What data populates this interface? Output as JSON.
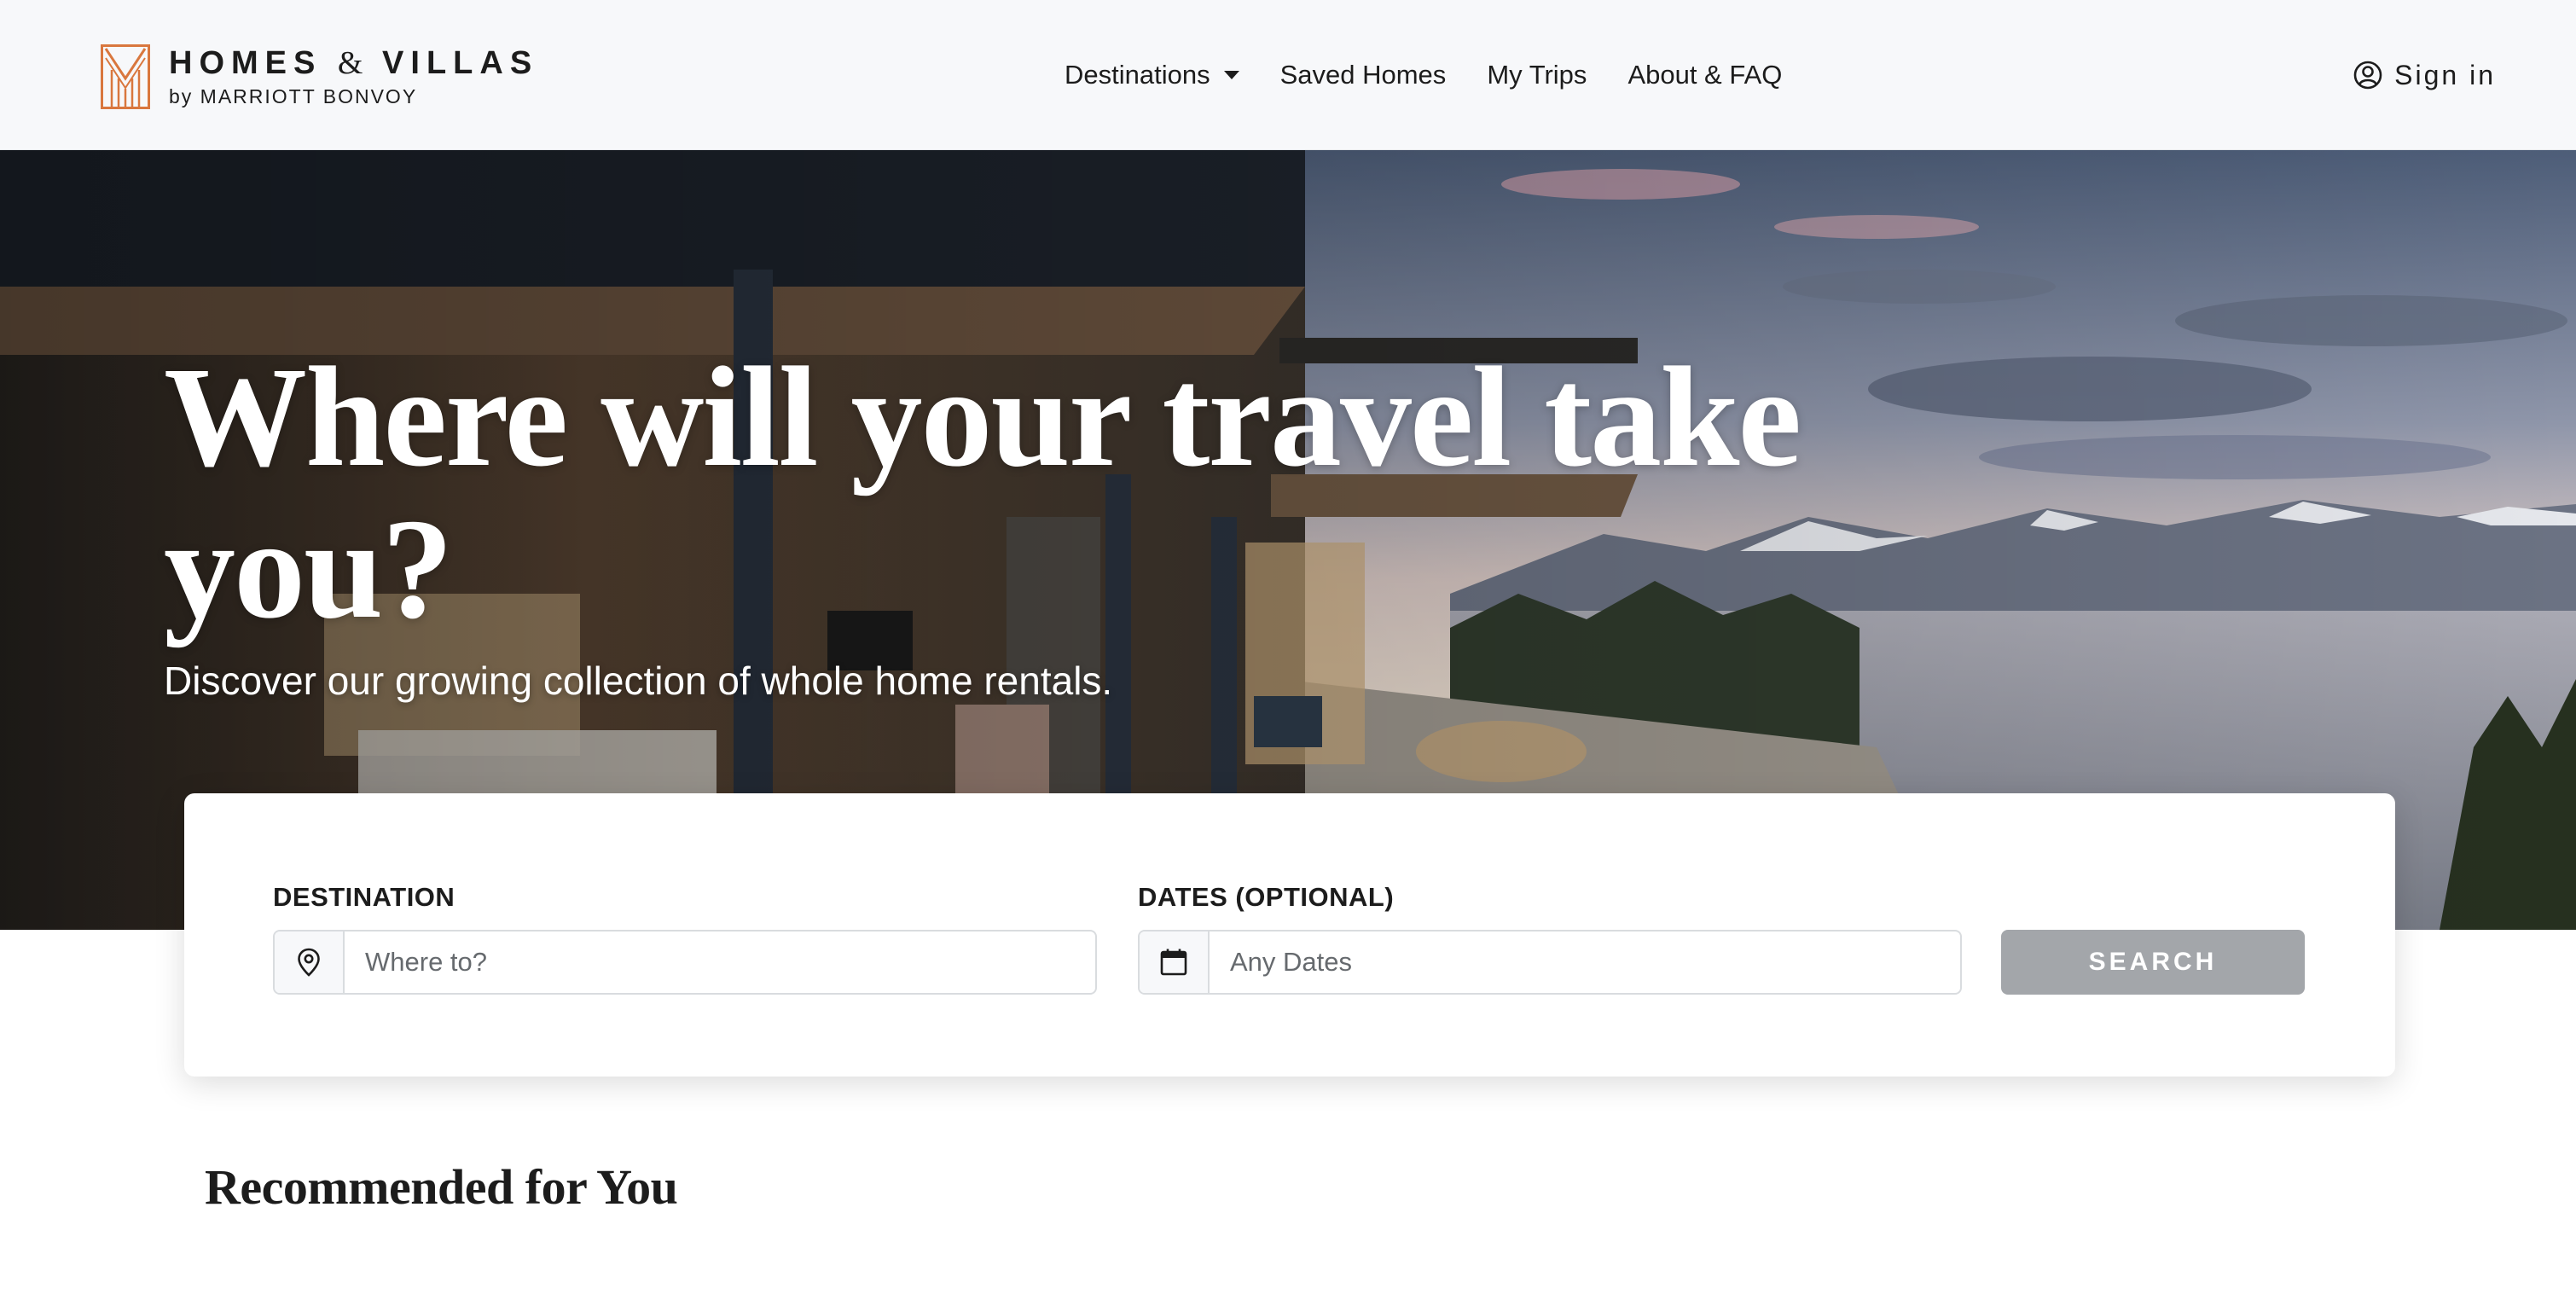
{
  "header": {
    "logo": {
      "brand_part1": "HOMES",
      "brand_amp": "&",
      "brand_part2": "VILLAS",
      "sub": "by MARRIOTT BONVOY",
      "accent_color": "#d9773e"
    },
    "nav": {
      "items": [
        {
          "label": "Destinations",
          "has_dropdown": true
        },
        {
          "label": "Saved Homes"
        },
        {
          "label": "My Trips"
        },
        {
          "label": "About & FAQ"
        }
      ]
    },
    "signin": {
      "label": "Sign in",
      "icon": "user-circle-icon"
    }
  },
  "hero": {
    "title": "Where will your travel take you?",
    "subtitle": "Discover our growing collection of whole home rentals.",
    "image": "modern villa terrace overlooking a mountain lake at dusk"
  },
  "search": {
    "destination": {
      "label": "DESTINATION",
      "placeholder": "Where to?",
      "value": "",
      "icon": "map-pin-icon"
    },
    "dates": {
      "label": "DATES (OPTIONAL)",
      "placeholder": "Any Dates",
      "value": "",
      "icon": "calendar-icon"
    },
    "button_label": "SEARCH",
    "button_color": "#a3a6aa"
  },
  "recommended": {
    "title": "Recommended for You"
  }
}
